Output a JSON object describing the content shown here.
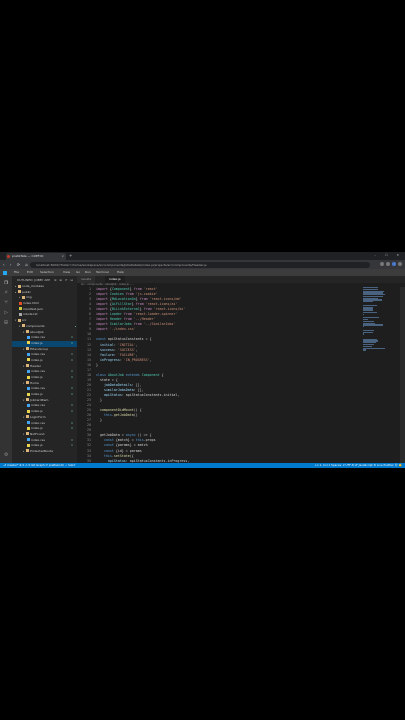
{
  "browser": {
    "tab_title": "pratikfate — COEF.IO",
    "tab_close": "×",
    "new_tab": "+",
    "window_controls": "– ☐ ✕",
    "nav_glyphs": "‹ › ⟳ ⌂",
    "url": "localhost:3000/?folder=/home/workspace/src/components/JobsDetails/index.js/projects/src/components/Header.js"
  },
  "menubar": {
    "items": [
      "File",
      "Edit",
      "Selection",
      "View",
      "Go",
      "Run",
      "Terminal",
      "Help"
    ],
    "title": ""
  },
  "activity_icons": [
    "files-icon",
    "search-icon",
    "source-control-icon",
    "run-debug-icon",
    "extensions-icon",
    "settings-icon"
  ],
  "sidebar": {
    "header": "OUTLINED: JOBBY APP",
    "tools": "⊕ ⊞ ⟳ ⊟",
    "tree": [
      {
        "label": "node_modules",
        "depth": 0,
        "type": "folder",
        "open": false,
        "badge": ""
      },
      {
        "label": "public",
        "depth": 0,
        "type": "folder",
        "open": false,
        "badge": ""
      },
      {
        "label": "img",
        "depth": 1,
        "type": "folder",
        "open": false,
        "badge": ""
      },
      {
        "label": "index.html",
        "depth": 1,
        "type": "html",
        "badge": ""
      },
      {
        "label": "manifest.json",
        "depth": 1,
        "type": "json",
        "badge": ""
      },
      {
        "label": "robots.txt",
        "depth": 1,
        "type": "txt",
        "badge": ""
      },
      {
        "label": "src",
        "depth": 0,
        "type": "folder",
        "open": true,
        "badge": ""
      },
      {
        "label": "components",
        "depth": 1,
        "type": "folder",
        "open": true,
        "badge": "",
        "dot": true
      },
      {
        "label": "AboutJob",
        "depth": 2,
        "type": "folder",
        "open": true,
        "badge": ""
      },
      {
        "label": "index.css",
        "depth": 3,
        "type": "css",
        "badge": "U"
      },
      {
        "label": "index.js",
        "depth": 3,
        "type": "js",
        "badge": "U",
        "selected": true
      },
      {
        "label": "FiltersGroup",
        "depth": 2,
        "type": "folder",
        "open": true,
        "badge": ""
      },
      {
        "label": "index.css",
        "depth": 3,
        "type": "css",
        "badge": "U"
      },
      {
        "label": "index.js",
        "depth": 3,
        "type": "js",
        "badge": "U"
      },
      {
        "label": "Header",
        "depth": 2,
        "type": "folder",
        "open": true,
        "badge": ""
      },
      {
        "label": "index.css",
        "depth": 3,
        "type": "css",
        "badge": "U"
      },
      {
        "label": "index.js",
        "depth": 3,
        "type": "js",
        "badge": "U"
      },
      {
        "label": "Home",
        "depth": 2,
        "type": "folder",
        "open": true,
        "badge": ""
      },
      {
        "label": "index.css",
        "depth": 3,
        "type": "css",
        "badge": "U"
      },
      {
        "label": "index.js",
        "depth": 3,
        "type": "js",
        "badge": "U"
      },
      {
        "label": "JobCardItem",
        "depth": 2,
        "type": "folder",
        "open": true,
        "badge": ""
      },
      {
        "label": "index.css",
        "depth": 3,
        "type": "css",
        "badge": "U"
      },
      {
        "label": "index.js",
        "depth": 3,
        "type": "js",
        "badge": "U"
      },
      {
        "label": "LoginForm",
        "depth": 2,
        "type": "folder",
        "open": true,
        "badge": ""
      },
      {
        "label": "index.css",
        "depth": 3,
        "type": "css",
        "badge": "U"
      },
      {
        "label": "index.js",
        "depth": 3,
        "type": "js",
        "badge": "U"
      },
      {
        "label": "NotFound",
        "depth": 2,
        "type": "folder",
        "open": true,
        "badge": ""
      },
      {
        "label": "index.css",
        "depth": 3,
        "type": "css",
        "badge": "U"
      },
      {
        "label": "index.js",
        "depth": 3,
        "type": "js",
        "badge": "U"
      },
      {
        "label": "ProtectedRoute",
        "depth": 2,
        "type": "folder",
        "open": false,
        "badge": ""
      }
    ]
  },
  "editor": {
    "tabs": [
      {
        "label": "results",
        "active": false
      },
      {
        "label": "index.js",
        "active": true
      }
    ],
    "breadcrumb": "src › components › AboutJob › index.js › ...",
    "code": [
      "import {Component} from 'react'",
      "import Cookies from 'js-cookie'",
      "import {MdLocationOn} from 'react-icons/md'",
      "import {AiFillStar} from 'react-icons/ai'",
      "import {BiLinkExternal} from 'react-icons/bi'",
      "import Loader from 'react-loader-spinner'",
      "import Header from '../Header'",
      "import SimilarJobs from '../SimilarJobs'",
      "import './index.css'",
      "",
      "const apiStatusConstants = {",
      "  initial: 'INITIAL',",
      "  success: 'SUCCESS',",
      "  failure: 'FAILURE',",
      "  inProgress: 'IN_PROGRESS',",
      "}",
      "",
      "class AboutJob extends Component {",
      "  state = {",
      "    jobDataDetails: [],",
      "    similarJobsData: [],",
      "    apiStatus: apiStatusConstants.initial,",
      "  }",
      "",
      "  componentDidMount() {",
      "    this.getJobData()",
      "  }",
      "",
      "",
      "  getJobData = async () => {",
      "    const {match} = this.props",
      "    const {params} = match",
      "    const {id} = params",
      "    this.setState({",
      "      apiStatus: apiStatusConstants.inProgress,",
      "    })"
    ]
  },
  "statusbar": {
    "left": "⎇ master*  ⊗ 0 ⚠ 0  Git Graph   ⟳ prettier(AI)  ✓ tslint",
    "right": "Ln 1, Col 1   Spaces: 2   UTF-8   LF   JavaScript   ⚙ Live   Prettier   ☺ 🔔"
  }
}
